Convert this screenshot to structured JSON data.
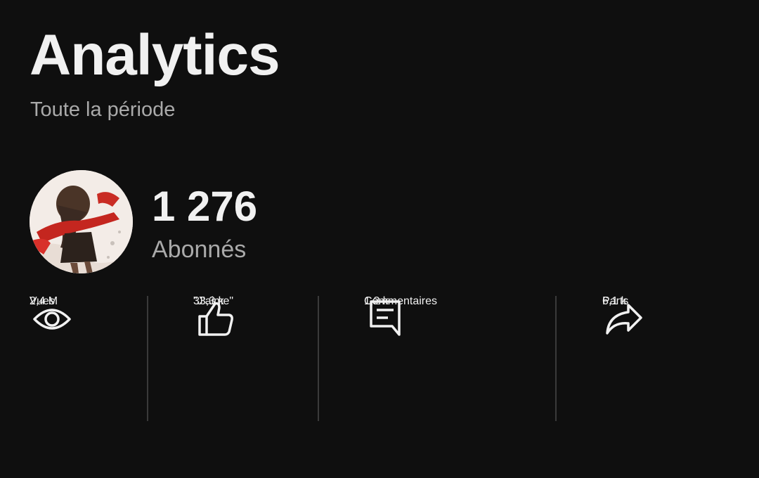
{
  "header": {
    "title": "Analytics",
    "period": "Toute la période"
  },
  "channel": {
    "subscriber_count": "1 276",
    "subscriber_label": "Abonnés"
  },
  "stats": [
    {
      "icon": "eye-icon",
      "value": "2,4 M",
      "label": "Vues"
    },
    {
      "icon": "thumbs-up-icon",
      "value": "33,3 k",
      "label": "\"J'aime\""
    },
    {
      "icon": "comment-icon",
      "value": "1,2 k",
      "label": "Commentaires"
    },
    {
      "icon": "share-icon",
      "value": "6,1 k",
      "label": "Parts"
    }
  ],
  "colors": {
    "background": "#0f0f0f",
    "primary_text": "#f1f1f1",
    "secondary_text": "#aaaaaa",
    "divider": "#3a3a3a"
  }
}
